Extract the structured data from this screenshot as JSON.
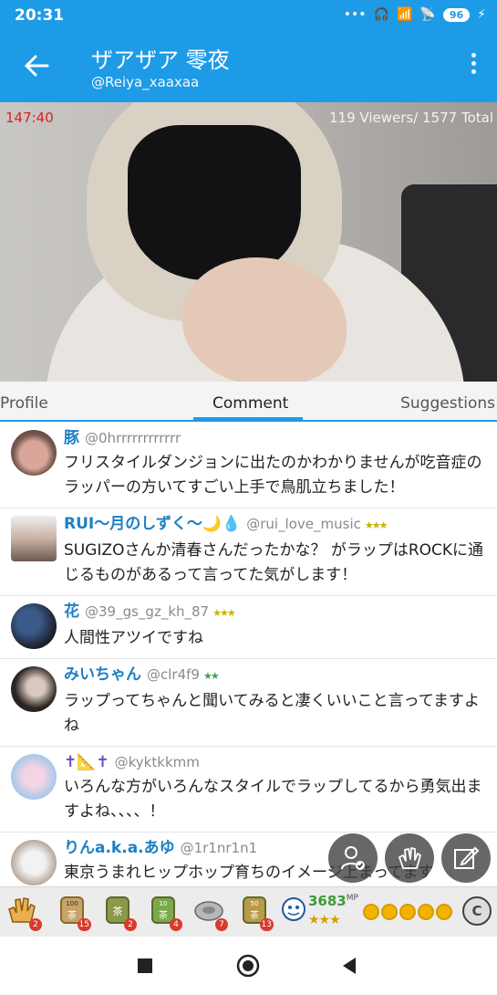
{
  "status_bar": {
    "time": "20:31",
    "battery": "96"
  },
  "header": {
    "title": "ザアザア 零夜",
    "subtitle": "@Reiya_xaaxaa"
  },
  "video": {
    "elapsed": "147:40",
    "viewers": "119 Viewers/ 1577 Total"
  },
  "tabs": [
    {
      "label": "Profile"
    },
    {
      "label": "Comment"
    },
    {
      "label": "Suggestions"
    }
  ],
  "comments": [
    {
      "name": "豚",
      "handle": "@0hrrrrrrrrrrrr",
      "badge": "",
      "text": "フリスタイルダンジョンに出たのかわかりませんが吃音症のラッパーの方いてすごい上手で鳥肌立ちました！"
    },
    {
      "name": "RUI〜月のしずく〜🌙💧",
      "handle": "@rui_love_music",
      "badge": "★★★",
      "text": "SUGIZOさんか清春さんだったかな？ がラップはROCKに通じるものがあるって言ってた気がします！"
    },
    {
      "name": "花",
      "handle": "@39_gs_gz_kh_87",
      "badge": "★★★",
      "text": "人間性アツイですね"
    },
    {
      "name": "みいちゃん",
      "handle": "@clr4f9",
      "badge": "★★",
      "text": "ラップってちゃんと聞いてみると凄くいいこと言ってますよね"
    },
    {
      "name": "✝📐✝",
      "handle": "@kyktkkmm",
      "badge": "",
      "text": "いろんな方がいろんなスタイルでラップしてるから勇気出ますよね、、、、！"
    },
    {
      "name": "りんa.k.a.あゆ",
      "handle": "@1r1nr1n1",
      "badge": "",
      "text": "東京うまれヒップホップ育ちのイメージ上まってます"
    }
  ],
  "gifts": [
    {
      "count": "2"
    },
    {
      "count": "15"
    },
    {
      "count": "2"
    },
    {
      "count": "4"
    },
    {
      "count": "7"
    },
    {
      "count": "13"
    }
  ],
  "gift_labels": [
    "100",
    "茶",
    "10",
    "50"
  ],
  "points": {
    "value": "3683",
    "unit": "MP",
    "stars": "★★★"
  },
  "c_button": "C",
  "colors": {
    "accent": "#1e9be6",
    "name": "#1e7fc4",
    "timer": "#e02020"
  }
}
